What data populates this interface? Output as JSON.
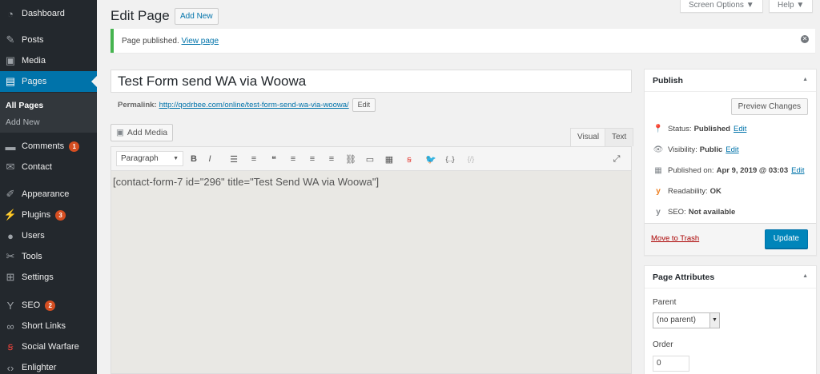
{
  "sidebar": {
    "items": [
      {
        "label": "Dashboard",
        "icon": "dashboard-icon",
        "glyph": "◔"
      },
      {
        "label": "Posts",
        "icon": "pin-icon",
        "glyph": "✎"
      },
      {
        "label": "Media",
        "icon": "media-icon",
        "glyph": "▣"
      },
      {
        "label": "Pages",
        "icon": "pages-icon",
        "glyph": "▤"
      },
      {
        "label": "Comments",
        "icon": "comments-icon",
        "glyph": "▬",
        "badge": "1"
      },
      {
        "label": "Contact",
        "icon": "mail-icon",
        "glyph": "✉"
      },
      {
        "label": "Appearance",
        "icon": "brush-icon",
        "glyph": "✐"
      },
      {
        "label": "Plugins",
        "icon": "plugin-icon",
        "glyph": "⚡",
        "badge": "3"
      },
      {
        "label": "Users",
        "icon": "users-icon",
        "glyph": "●"
      },
      {
        "label": "Tools",
        "icon": "wrench-icon",
        "glyph": "✂"
      },
      {
        "label": "Settings",
        "icon": "settings-icon",
        "glyph": "⊞"
      },
      {
        "label": "SEO",
        "icon": "yoast-icon",
        "glyph": "Y",
        "badge": "2"
      },
      {
        "label": "Short Links",
        "icon": "link-icon",
        "glyph": "∞"
      },
      {
        "label": "Social Warfare",
        "icon": "social-warfare-icon",
        "glyph": "ꞩ"
      },
      {
        "label": "Enlighter",
        "icon": "code-icon",
        "glyph": "‹›"
      }
    ],
    "submenu": [
      "All Pages",
      "Add New"
    ]
  },
  "header": {
    "title": "Edit Page",
    "add_new": "Add New",
    "screen_options": "Screen Options ▼",
    "help": "Help ▼"
  },
  "notice": {
    "text": "Page published.",
    "link": "View page"
  },
  "editor": {
    "title_value": "Test Form send WA via Woowa",
    "permalink_label": "Permalink:",
    "permalink_url": "http://qodrbee.com/online/test-form-send-wa-via-woowa/",
    "permalink_edit": "Edit",
    "add_media": "Add Media",
    "tab_visual": "Visual",
    "tab_text": "Text",
    "format": "Paragraph",
    "content": "[contact-form-7 id=\"296\" title=\"Test Send WA via Woowa\"]",
    "toolbar": [
      {
        "name": "bold-icon",
        "glyph": "B"
      },
      {
        "name": "italic-icon",
        "glyph": "I"
      },
      {
        "name": "bullet-list-icon",
        "glyph": "☰"
      },
      {
        "name": "numbered-list-icon",
        "glyph": "≡"
      },
      {
        "name": "blockquote-icon",
        "glyph": "❝"
      },
      {
        "name": "align-left-icon",
        "glyph": "≡"
      },
      {
        "name": "align-center-icon",
        "glyph": "≡"
      },
      {
        "name": "align-right-icon",
        "glyph": "≡"
      },
      {
        "name": "link-icon",
        "glyph": "⛓"
      },
      {
        "name": "read-more-icon",
        "glyph": "▭"
      },
      {
        "name": "toolbar-toggle-icon",
        "glyph": "▦"
      },
      {
        "name": "social-warfare-icon",
        "glyph": "ꞩ"
      },
      {
        "name": "twitter-icon",
        "glyph": "🐦"
      },
      {
        "name": "code-brackets-icon",
        "glyph": "{..}"
      },
      {
        "name": "code-disabled-icon",
        "glyph": "{/}"
      }
    ]
  },
  "publish": {
    "title": "Publish",
    "preview": "Preview Changes",
    "status_label": "Status:",
    "status_value": "Published",
    "visibility_label": "Visibility:",
    "visibility_value": "Public",
    "published_label": "Published on:",
    "published_value": "Apr 9, 2019 @ 03:03",
    "readability_label": "Readability:",
    "readability_value": "OK",
    "seo_label": "SEO:",
    "seo_value": "Not available",
    "edit": "Edit",
    "trash": "Move to Trash",
    "update": "Update"
  },
  "attributes": {
    "title": "Page Attributes",
    "parent_label": "Parent",
    "parent_value": "(no parent)",
    "order_label": "Order",
    "order_value": "0"
  },
  "colors": {
    "sidebar_bg": "#23282d",
    "accent": "#0073aa",
    "badge": "#d54e21",
    "notice_success": "#46b450",
    "trash": "#a00"
  }
}
